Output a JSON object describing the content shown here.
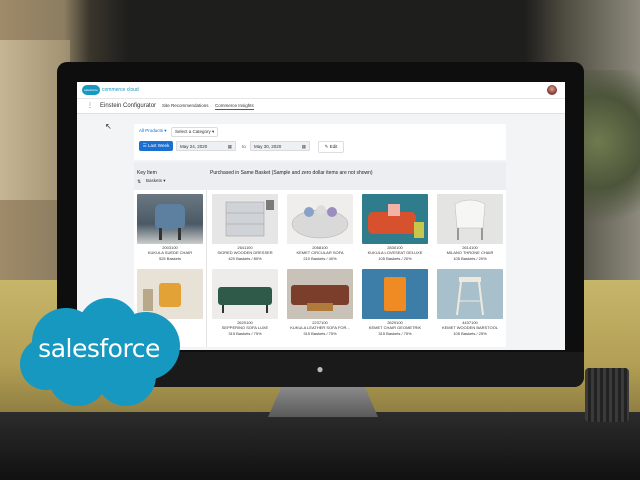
{
  "brand": {
    "mini_logo": "salesforce",
    "subtitle": "commerce cloud",
    "big_logo": "salesforce",
    "accent": "#1798c1"
  },
  "nav": {
    "app_name": "Einstein Configurator",
    "tabs": [
      "Site Recommendations",
      "Commerce Insights"
    ],
    "active_tab": "Commerce Insights"
  },
  "filters": {
    "products_dropdown": "All Products",
    "category_dropdown": "Select a Category",
    "last_week_button": "Last Week",
    "start_date": "May 24, 2020",
    "to_label": "to",
    "end_date": "May 30, 2020",
    "edit_button": "Edit"
  },
  "results": {
    "key_item_header": "Key Item",
    "sort_label": "Baskets",
    "purchased_header": "Purchased in Same Basket (Sample and zero dollar items are not shown)",
    "items": [
      {
        "sku": "2003100",
        "name": "KUKULA SUEDE CHAIR",
        "stat": "525 Baskets",
        "icon": "blue-chair"
      },
      {
        "sku": "2641100",
        "name": "SIGRED WOODEN DRESSER",
        "stat": "420 Baskets / 80%",
        "icon": "dresser"
      },
      {
        "sku": "2068100",
        "name": "KEMET CIRCULAR SOFA",
        "stat": "210 Baskets / 40%",
        "icon": "round-sofa"
      },
      {
        "sku": "2830100",
        "name": "KUKULA LOVESEAT DELUXE",
        "stat": "105 Baskets / 20%",
        "icon": "orange-loveseat"
      },
      {
        "sku": "2614100",
        "name": "MILANO THRONE CHAIR",
        "stat": "105 Baskets / 20%",
        "icon": "white-chair"
      },
      {
        "sku": "",
        "name": "",
        "stat": "",
        "icon": "yellow-armchair"
      },
      {
        "sku": "2620100",
        "name": "SEPPERINO SOFA LUXE",
        "stat": "315 Baskets / 75%",
        "icon": "green-sofa"
      },
      {
        "sku": "2237100",
        "name": "KUKULA LEATHER SOFA FOR...",
        "stat": "315 Baskets / 75%",
        "icon": "leather-sofa"
      },
      {
        "sku": "2629100",
        "name": "KEMET CHAIR GEOMETRIK",
        "stat": "315 Baskets / 75%",
        "icon": "orange-chair"
      },
      {
        "sku": "4437100",
        "name": "KEMET WOODEN BARSTOOL",
        "stat": "105 Baskets / 25%",
        "icon": "barstool"
      }
    ]
  }
}
